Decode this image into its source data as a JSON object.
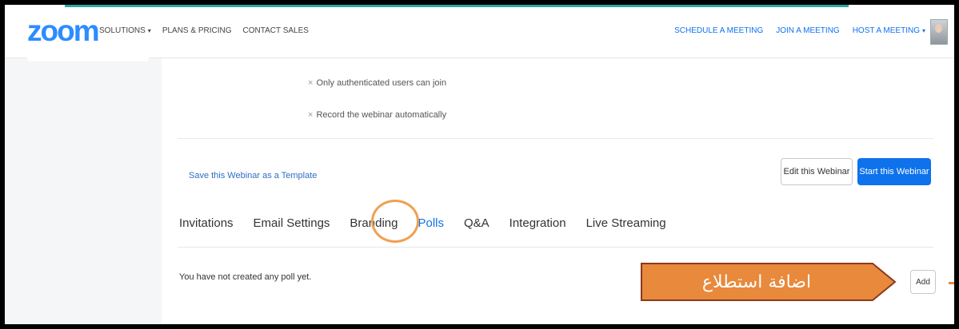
{
  "header": {
    "logo": "zoom",
    "nav_left": [
      {
        "label": "SOLUTIONS",
        "caret": "▾"
      },
      {
        "label": "PLANS & PRICING",
        "caret": ""
      },
      {
        "label": "CONTACT SALES",
        "caret": ""
      }
    ],
    "nav_right": [
      {
        "label": "SCHEDULE A MEETING",
        "caret": ""
      },
      {
        "label": "JOIN A MEETING",
        "caret": ""
      },
      {
        "label": "HOST A MEETING",
        "caret": "▾"
      }
    ]
  },
  "options": [
    {
      "mark": "×",
      "label": "Only authenticated users can join"
    },
    {
      "mark": "×",
      "label": "Record the webinar automatically"
    }
  ],
  "actions": {
    "save_template": "Save this Webinar as a Template",
    "edit": "Edit this Webinar",
    "start": "Start this Webinar"
  },
  "tabs": [
    {
      "label": "Invitations",
      "active": false
    },
    {
      "label": "Email Settings",
      "active": false
    },
    {
      "label": "Branding",
      "active": false
    },
    {
      "label": "Polls",
      "active": true
    },
    {
      "label": "Q&A",
      "active": false
    },
    {
      "label": "Integration",
      "active": false
    },
    {
      "label": "Live Streaming",
      "active": false
    }
  ],
  "polls": {
    "empty_message": "You have not created any poll yet.",
    "add_label": "Add"
  },
  "annotation": {
    "text": "اضافة استطلاع",
    "fill_color": "#e8893b",
    "border_color": "#8b3a1a"
  },
  "colors": {
    "brand": "#2d8cff",
    "accent": "#0e72ed",
    "highlight": "#f0a050"
  }
}
